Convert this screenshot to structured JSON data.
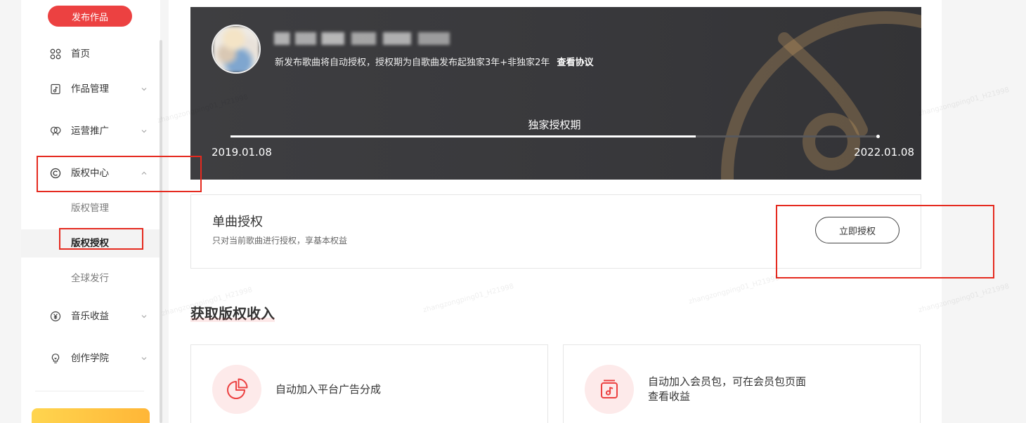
{
  "sidebar": {
    "publish_label": "发布作品",
    "items": [
      {
        "label": "首页",
        "icon": "grid-icon"
      },
      {
        "label": "作品管理",
        "icon": "music-file-icon",
        "expandable": true,
        "expanded": false
      },
      {
        "label": "运营推广",
        "icon": "chat-bubbles-icon",
        "expandable": true,
        "expanded": false
      },
      {
        "label": "版权中心",
        "icon": "copyright-icon",
        "expandable": true,
        "expanded": true,
        "children": [
          {
            "label": "版权管理",
            "active": false
          },
          {
            "label": "版权授权",
            "active": true
          },
          {
            "label": "全球发行",
            "active": false
          }
        ]
      },
      {
        "label": "音乐收益",
        "icon": "yen-icon",
        "expandable": true,
        "expanded": false
      },
      {
        "label": "创作学院",
        "icon": "lightbulb-icon",
        "expandable": true,
        "expanded": false
      }
    ]
  },
  "banner": {
    "notice": "新发布歌曲将自动授权，授权期为自歌曲发布起独家3年+非独家2年",
    "agreement_link": "查看协议",
    "period_label": "独家授权期",
    "start_date": "2019.01.08",
    "end_date": "2022.01.08",
    "progress": 0.718
  },
  "single_license": {
    "title": "单曲授权",
    "description": "只对当前歌曲进行授权，享基本权益",
    "button_label": "立即授权"
  },
  "income_section": {
    "heading": "获取版权收入",
    "cards": [
      {
        "icon": "pie-chart-icon",
        "text": "自动加入平台广告分成"
      },
      {
        "icon": "music-album-icon",
        "lines": [
          "自动加入会员包，可在会员包页面",
          "查看收益"
        ]
      }
    ]
  },
  "watermark": "zhangzongping01_H21998",
  "colors": {
    "accent": "#ec4141",
    "banner_bg": "#3a3a3d",
    "annotation": "#e52a1f"
  }
}
